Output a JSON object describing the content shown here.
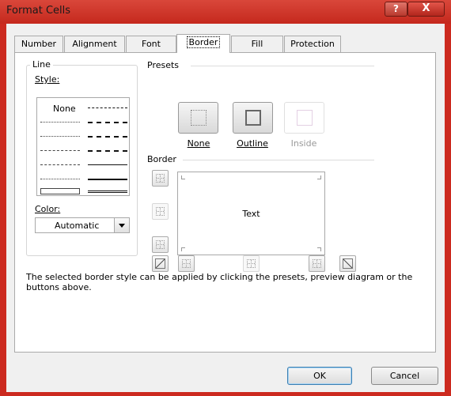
{
  "window": {
    "title": "Format Cells",
    "help_glyph": "?",
    "close_glyph": "X"
  },
  "tabs": [
    {
      "label": "Number"
    },
    {
      "label": "Alignment"
    },
    {
      "label": "Font"
    },
    {
      "label": "Border",
      "active": true
    },
    {
      "label": "Fill"
    },
    {
      "label": "Protection"
    }
  ],
  "line": {
    "group_label": "Line",
    "style_label": "Style:",
    "none_option": "None",
    "color_label": "Color:",
    "color_value": "Automatic"
  },
  "presets": {
    "group_label": "Presets",
    "none": "None",
    "outline": "Outline",
    "inside": "Inside"
  },
  "border": {
    "group_label": "Border",
    "preview_text": "Text"
  },
  "info_text": "The selected border style can be applied by clicking the presets, preview diagram or the buttons above.",
  "buttons": {
    "ok": "OK",
    "cancel": "Cancel"
  },
  "colors": {
    "title_bar": "#cc2a1f",
    "dialog_bg": "#f0f0f0",
    "ok_border": "#3c7fb1"
  }
}
